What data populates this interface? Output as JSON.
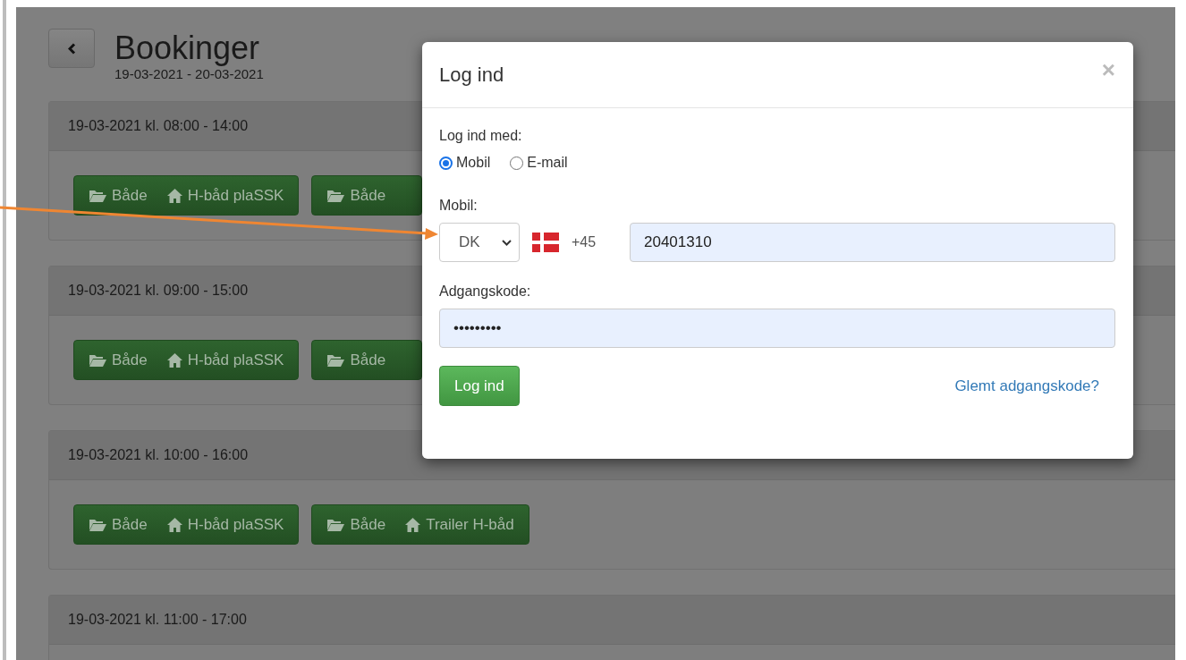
{
  "page": {
    "title": "Bookinger",
    "date_range": "19-03-2021 - 20-03-2021"
  },
  "bookings": [
    {
      "time": "19-03-2021 kl. 08:00 - 14:00",
      "buttons": [
        {
          "items": [
            {
              "kind": "folder",
              "label": "Både"
            },
            {
              "kind": "home",
              "label": "H-båd plaSSK"
            }
          ]
        },
        {
          "items": [
            {
              "kind": "folder",
              "label": "Både"
            }
          ]
        }
      ]
    },
    {
      "time": "19-03-2021 kl. 09:00 - 15:00",
      "buttons": [
        {
          "items": [
            {
              "kind": "folder",
              "label": "Både"
            },
            {
              "kind": "home",
              "label": "H-båd plaSSK"
            }
          ]
        },
        {
          "items": [
            {
              "kind": "folder",
              "label": "Både"
            }
          ]
        }
      ]
    },
    {
      "time": "19-03-2021 kl. 10:00 - 16:00",
      "buttons": [
        {
          "items": [
            {
              "kind": "folder",
              "label": "Både"
            },
            {
              "kind": "home",
              "label": "H-båd plaSSK"
            }
          ]
        },
        {
          "items": [
            {
              "kind": "folder",
              "label": "Både"
            },
            {
              "kind": "home",
              "label": "Trailer H-båd"
            }
          ]
        }
      ]
    },
    {
      "time": "19-03-2021 kl. 11:00 - 17:00"
    }
  ],
  "login_dialog": {
    "title": "Log ind",
    "close": "×",
    "method_label": "Log ind med:",
    "methods": [
      {
        "label": "Mobil",
        "selected": true
      },
      {
        "label": "E-mail",
        "selected": false
      }
    ],
    "mobile_label": "Mobil:",
    "country": "DK",
    "dial_code": "+45",
    "mobile": "20401310",
    "password_label": "Adgangskode:",
    "password": "•••••••••",
    "submit": "Log ind",
    "forgot_link": "Glemt adgangskode?"
  }
}
